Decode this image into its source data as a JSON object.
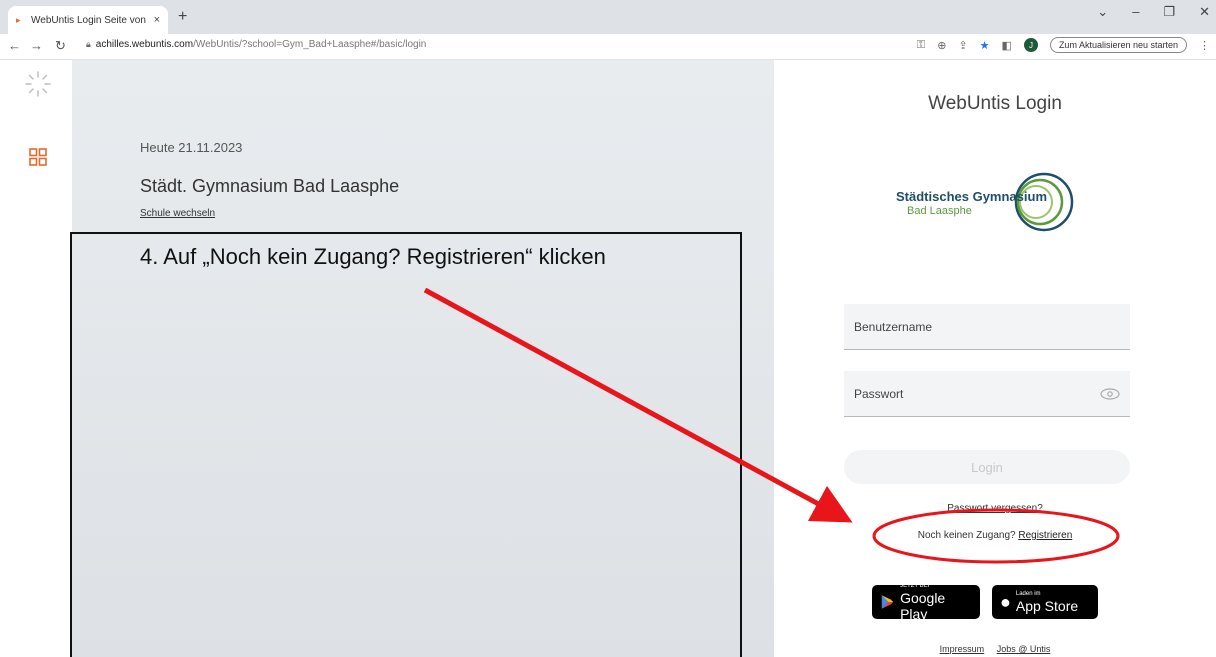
{
  "browser": {
    "tab_title": "WebUntis Login Seite von Städt",
    "tab_close": "×",
    "new_tab": "+",
    "url_host": "achilles.webuntis.com",
    "url_path": "/WebUntis/?school=Gym_Bad+Laasphe#/basic/login",
    "update_button": "Zum Aktualisieren neu starten",
    "avatar_letter": "J",
    "icons": [
      "back-icon",
      "forward-icon",
      "reload-icon",
      "lock-icon",
      "key-icon",
      "zoom-icon",
      "share-icon",
      "star-icon",
      "sidepanel-icon",
      "menu-icon"
    ]
  },
  "middle": {
    "today": "Heute 21.11.2023",
    "school_name": "Städt. Gymnasium Bad Laasphe",
    "switch_school": "Schule wechseln",
    "annotation": "4.   Auf „Noch kein Zugang? Registrieren“ klicken"
  },
  "login": {
    "title": "WebUntis Login",
    "logo_line1": "Städtisches Gymnasium",
    "logo_line2": "Bad Laasphe",
    "username_placeholder": "Benutzername",
    "password_placeholder": "Passwort",
    "login_button": "Login",
    "forgot_password": "Passwort vergessen?",
    "register_prefix": "Noch keinen Zugang? ",
    "register_link": "Registrieren",
    "google_play_small": "JETZT BEI",
    "google_play_big": "Google Play",
    "app_store_small": "Laden im",
    "app_store_big": "App Store",
    "impressum": "Impressum",
    "jobs": "Jobs @ Untis"
  },
  "colors": {
    "accent_orange": "#e26b2c",
    "annotation_red": "#e8151b",
    "logo_blue": "#1d4e6a",
    "logo_green": "#5b9a3c"
  }
}
